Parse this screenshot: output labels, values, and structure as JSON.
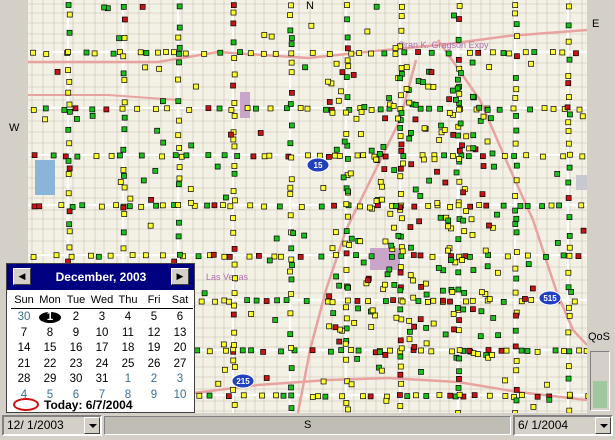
{
  "compass": {
    "north": "N",
    "east": "E",
    "west": "W",
    "south": "S"
  },
  "map": {
    "labels": [
      "Oran K. Gragson Expy",
      "Las Vegas"
    ],
    "highway_shields": [
      "15",
      "515",
      "215"
    ],
    "colors": {
      "background": "#f3f0e6",
      "street": "#ffffff",
      "arterial": "#e8a3a0",
      "grid": "#c8c0b0",
      "water": "#8ab4d8",
      "park": "#c9a6c9",
      "good": "#19c019",
      "fair": "#ffff2b",
      "bad": "#c81414",
      "shield": "#2040c0"
    }
  },
  "calendar": {
    "month_title": "December, 2003",
    "prev_icon": "left-arrow-icon",
    "next_icon": "right-arrow-icon",
    "weekdays": [
      "Sun",
      "Mon",
      "Tue",
      "Wed",
      "Thu",
      "Fri",
      "Sat"
    ],
    "weeks": [
      [
        {
          "d": "30",
          "o": true
        },
        {
          "d": "1",
          "s": true
        },
        {
          "d": "2"
        },
        {
          "d": "3"
        },
        {
          "d": "4"
        },
        {
          "d": "5"
        },
        {
          "d": "6"
        }
      ],
      [
        {
          "d": "7"
        },
        {
          "d": "8"
        },
        {
          "d": "9"
        },
        {
          "d": "10"
        },
        {
          "d": "11"
        },
        {
          "d": "12"
        },
        {
          "d": "13"
        }
      ],
      [
        {
          "d": "14"
        },
        {
          "d": "15"
        },
        {
          "d": "16"
        },
        {
          "d": "17"
        },
        {
          "d": "18"
        },
        {
          "d": "19"
        },
        {
          "d": "20"
        }
      ],
      [
        {
          "d": "21"
        },
        {
          "d": "22"
        },
        {
          "d": "23"
        },
        {
          "d": "24"
        },
        {
          "d": "25"
        },
        {
          "d": "26"
        },
        {
          "d": "27"
        }
      ],
      [
        {
          "d": "28"
        },
        {
          "d": "29"
        },
        {
          "d": "30"
        },
        {
          "d": "31"
        },
        {
          "d": "1",
          "o": true
        },
        {
          "d": "2",
          "o": true
        },
        {
          "d": "3",
          "o": true
        }
      ],
      [
        {
          "d": "4",
          "o": true
        },
        {
          "d": "5",
          "o": true
        },
        {
          "d": "6",
          "o": true
        },
        {
          "d": "7",
          "o": true
        },
        {
          "d": "8",
          "o": true
        },
        {
          "d": "9",
          "o": true
        },
        {
          "d": "10",
          "o": true
        }
      ]
    ],
    "today_label": "Today: 6/7/2004"
  },
  "bottom_bar": {
    "start_date": "12/ 1/2003",
    "end_date": "6/ 1/2004"
  },
  "qos": {
    "label": "QoS",
    "level": 0.5
  }
}
